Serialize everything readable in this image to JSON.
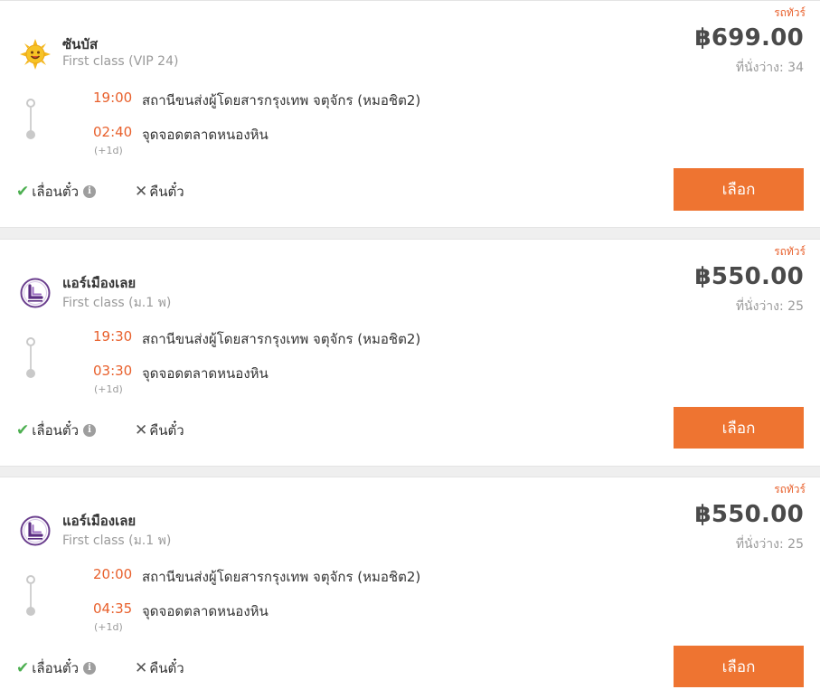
{
  "trips": [
    {
      "tag": "รถทัวร์",
      "operator": "ซันบัส",
      "bus_class": "First class (VIP 24)",
      "logo": "sun-logo-icon",
      "price": "฿699.00",
      "seats": "ที่นั่งว่าง: 34",
      "dep_time": "19:00",
      "dep_place": "สถานีขนส่งผู้โดยสารกรุงเทพ จตุจักร (หมอชิต2)",
      "arr_time": "02:40",
      "arr_place": "จุดจอดตลาดหนองหิน",
      "next_day": "(+1d)",
      "change_label": "เลื่อนตั๋ว",
      "refund_label": "คืนตั๋ว",
      "button_label": "เลือก"
    },
    {
      "tag": "รถทัวร์",
      "operator": "แอร์เมืองเลย",
      "bus_class": "First class (ม.1 พ)",
      "logo": "air-muang-loei-logo-icon",
      "price": "฿550.00",
      "seats": "ที่นั่งว่าง: 25",
      "dep_time": "19:30",
      "dep_place": "สถานีขนส่งผู้โดยสารกรุงเทพ จตุจักร (หมอชิต2)",
      "arr_time": "03:30",
      "arr_place": "จุดจอดตลาดหนองหิน",
      "next_day": "(+1d)",
      "change_label": "เลื่อนตั๋ว",
      "refund_label": "คืนตั๋ว",
      "button_label": "เลือก"
    },
    {
      "tag": "รถทัวร์",
      "operator": "แอร์เมืองเลย",
      "bus_class": "First class (ม.1 พ)",
      "logo": "air-muang-loei-logo-icon",
      "price": "฿550.00",
      "seats": "ที่นั่งว่าง: 25",
      "dep_time": "20:00",
      "dep_place": "สถานีขนส่งผู้โดยสารกรุงเทพ จตุจักร (หมอชิต2)",
      "arr_time": "04:35",
      "arr_place": "จุดจอดตลาดหนองหิน",
      "next_day": "(+1d)",
      "change_label": "เลื่อนตั๋ว",
      "refund_label": "คืนตั๋ว",
      "button_label": "เลือก"
    }
  ],
  "icons": {
    "change_ok": "check-icon",
    "refund_no": "cross-icon",
    "info": "info-icon"
  },
  "colors": {
    "accent": "#ee7431",
    "time": "#e8602c",
    "check": "#4caf50"
  }
}
